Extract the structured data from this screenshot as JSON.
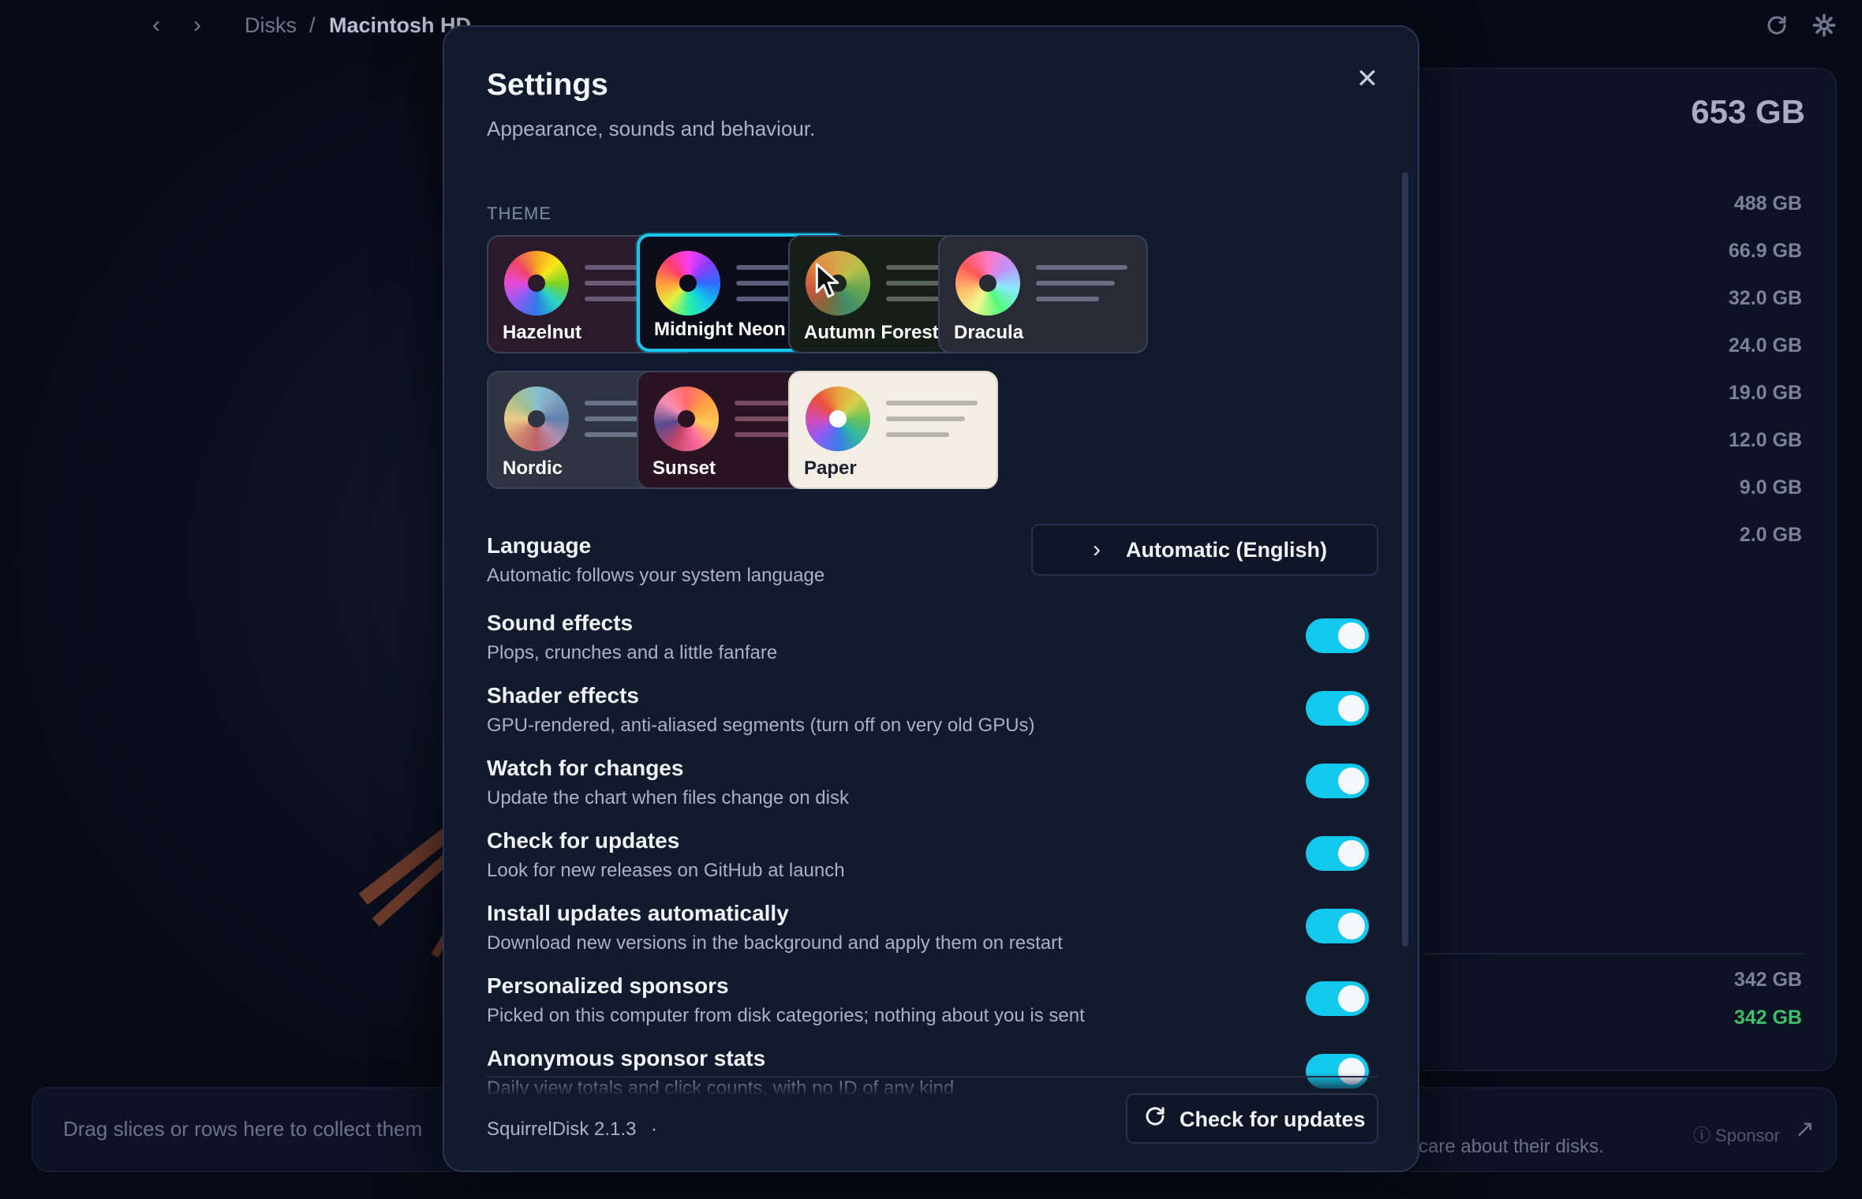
{
  "topbar": {
    "back_icon": "chevron-left-icon",
    "forward_icon": "chevron-right-icon",
    "breadcrumb": [
      "Disks",
      "Macintosh HD"
    ],
    "separator": "/",
    "refresh_icon": "refresh-icon",
    "settings_icon": "gear-icon"
  },
  "right_panel": {
    "total": "653 GB",
    "sizes": [
      "488 GB",
      "66.9 GB",
      "32.0 GB",
      "24.0 GB",
      "19.0 GB",
      "12.0 GB",
      "9.0 GB",
      "2.0 GB"
    ],
    "footer_sizes": [
      "342 GB",
      "342 GB"
    ]
  },
  "bottom": {
    "dropzone_text": "Drag slices or rows here to collect them",
    "sponsor_tail": "care about their disks.",
    "sponsor_label": "Sponsor"
  },
  "modal": {
    "title": "Settings",
    "subtitle": "Appearance, sounds and behaviour.",
    "close_icon": "close-icon",
    "theme_label": "THEME",
    "themes": [
      {
        "name": "Hazelnut",
        "bg": "#2a1a2c",
        "hole": "#2a1a2c",
        "line": "#6a5a78"
      },
      {
        "name": "Midnight Neon",
        "bg": "#0c0c1a",
        "hole": "#0c0c1a",
        "line": "#5a607a",
        "selected": true
      },
      {
        "name": "Autumn Forest",
        "bg": "#161e1a",
        "hole": "#1b261f",
        "line": "#59645a"
      },
      {
        "name": "Dracula",
        "bg": "#282a36",
        "hole": "#282a36",
        "line": "#6a6d82"
      },
      {
        "name": "Nordic",
        "bg": "#2e3442",
        "hole": "#2e3442",
        "line": "#6a7385"
      },
      {
        "name": "Sunset",
        "bg": "#2a1424",
        "hole": "#2a1424",
        "line": "#7a4a5e"
      },
      {
        "name": "Paper",
        "bg": "#f2eee3",
        "hole": "#ffffff",
        "line": "#b9b6ad"
      }
    ],
    "language": {
      "title": "Language",
      "description": "Automatic follows your system language",
      "value": "Automatic (English)"
    },
    "settings": [
      {
        "title": "Sound effects",
        "description": "Plops, crunches and a little fanfare",
        "enabled": true
      },
      {
        "title": "Shader effects",
        "description": "GPU-rendered, anti-aliased segments (turn off on very old GPUs)",
        "enabled": true
      },
      {
        "title": "Watch for changes",
        "description": "Update the chart when files change on disk",
        "enabled": true
      },
      {
        "title": "Check for updates",
        "description": "Look for new releases on GitHub at launch",
        "enabled": true
      },
      {
        "title": "Install updates automatically",
        "description": "Download new versions in the background and apply them on restart",
        "enabled": true
      },
      {
        "title": "Personalized sponsors",
        "description": "Picked on this computer from disk categories; nothing about you is sent",
        "enabled": true
      },
      {
        "title": "Anonymous sponsor stats",
        "description": "Daily view totals and click counts, with no ID of any kind",
        "enabled": true
      }
    ],
    "footer": {
      "version": "SquirrelDisk 2.1.3",
      "dot": "·",
      "update_button": "Check for updates",
      "update_icon": "refresh-icon"
    }
  },
  "colors": {
    "accent": "#12c8ec",
    "modal_bg": "#121a2e",
    "app_bg": "#070b17",
    "green_value": "#3fbf6a"
  }
}
